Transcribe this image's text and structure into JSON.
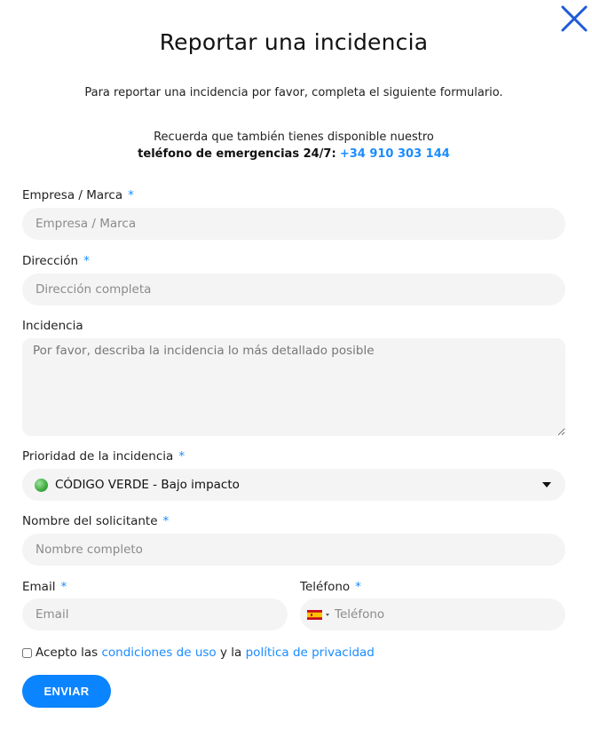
{
  "title": "Reportar una incidencia",
  "intro": "Para reportar una incidencia por favor, completa el siguiente formulario.",
  "remember": {
    "line1": "Recuerda que también tienes disponible nuestro",
    "bold": "teléfono de emergencias 24/7:",
    "phone": "+34 910 303 144"
  },
  "form": {
    "required_mark": "*",
    "company": {
      "label": "Empresa / Marca",
      "placeholder": "Empresa / Marca"
    },
    "address": {
      "label": "Dirección",
      "placeholder": "Dirección completa"
    },
    "incident": {
      "label": "Incidencia",
      "placeholder": "Por favor, describa la incidencia lo más detallado posible"
    },
    "priority": {
      "label": "Prioridad de la incidencia",
      "value": "CÓDIGO VERDE - Bajo impacto",
      "indicator_color": "#3daa3d"
    },
    "requester": {
      "label": "Nombre del solicitante",
      "placeholder": "Nombre completo"
    },
    "email": {
      "label": "Email",
      "placeholder": "Email"
    },
    "phone": {
      "label": "Teléfono",
      "placeholder": "Teléfono",
      "country_flag": "spain-flag-icon"
    },
    "consent": {
      "prefix": "Acepto las",
      "terms_link": "condiciones de uso",
      "middle": "y la",
      "privacy_link": "política de privacidad"
    },
    "submit_label": "ENVIAR"
  },
  "icons": {
    "close": "close-icon"
  },
  "colors": {
    "accent": "#0b84ff",
    "link": "#1a8cff",
    "field_bg": "#f4f4f4",
    "close": "#1e5bd6"
  }
}
